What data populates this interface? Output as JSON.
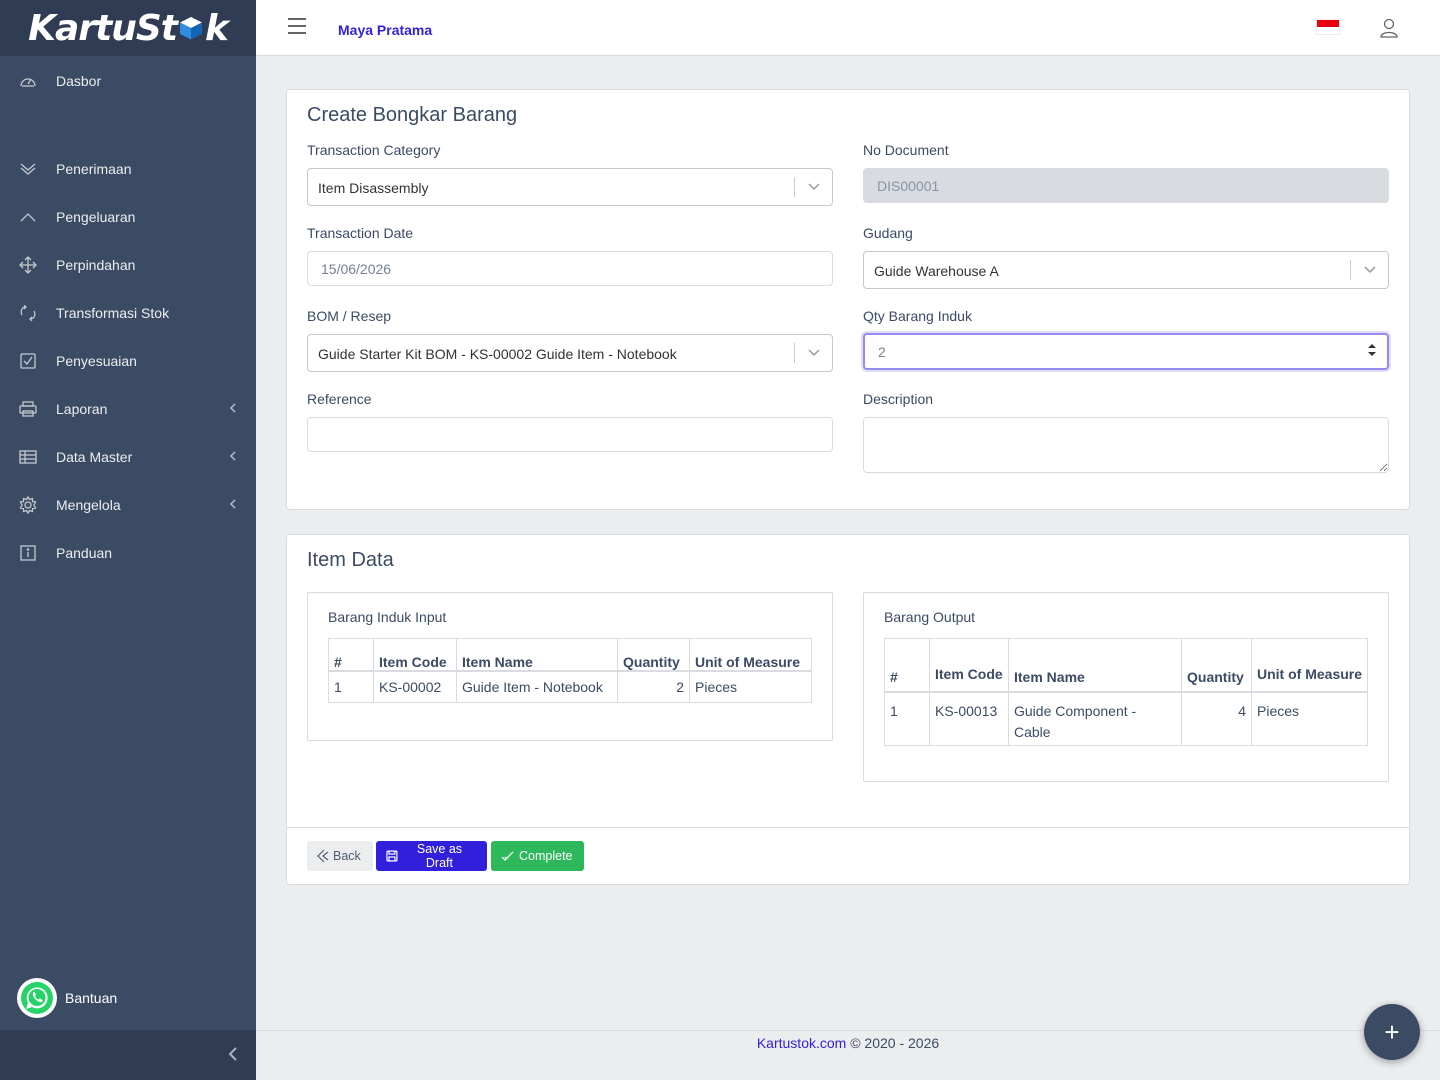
{
  "brand": {
    "name_part1": "KartuSt",
    "name_part2": "k"
  },
  "sidebar": {
    "items": [
      {
        "label": "Dasbor",
        "icon": "speedometer-icon"
      },
      {
        "label": "Penerimaan",
        "icon": "chevron-double-down-icon"
      },
      {
        "label": "Pengeluaran",
        "icon": "chevron-up-icon"
      },
      {
        "label": "Perpindahan",
        "icon": "move-icon"
      },
      {
        "label": "Transformasi Stok",
        "icon": "transform-icon"
      },
      {
        "label": "Penyesuaian",
        "icon": "checkbox-icon"
      },
      {
        "label": "Laporan",
        "icon": "printer-icon"
      },
      {
        "label": "Data Master",
        "icon": "list-icon"
      },
      {
        "label": "Mengelola",
        "icon": "gear-icon"
      },
      {
        "label": "Panduan",
        "icon": "info-icon"
      }
    ],
    "help_label": "Bantuan"
  },
  "header": {
    "user_name": "Maya Pratama"
  },
  "form": {
    "title": "Create Bongkar Barang",
    "transaction_category": {
      "label": "Transaction Category",
      "value": "Item Disassembly"
    },
    "no_document": {
      "label": "No Document",
      "value": "DIS00001"
    },
    "transaction_date": {
      "label": "Transaction Date",
      "value": "15/06/2026"
    },
    "gudang": {
      "label": "Gudang",
      "value": "Guide Warehouse A"
    },
    "bom": {
      "label": "BOM / Resep",
      "value": "Guide Starter Kit BOM - KS-00002 Guide Item - Notebook"
    },
    "qty": {
      "label": "Qty Barang Induk",
      "value": "2"
    },
    "reference": {
      "label": "Reference",
      "value": ""
    },
    "description": {
      "label": "Description",
      "value": ""
    }
  },
  "items": {
    "title": "Item Data",
    "input": {
      "title": "Barang Induk Input",
      "headers": [
        "#",
        "Item Code",
        "Item Name",
        "Quantity",
        "Unit of Measure"
      ],
      "rows": [
        [
          "1",
          "KS-00002",
          "Guide Item - Notebook",
          "2",
          "Pieces"
        ]
      ]
    },
    "output": {
      "title": "Barang Output",
      "headers": [
        "#",
        "Item Code",
        "Item Name",
        "Quantity",
        "Unit of Measure"
      ],
      "rows": [
        [
          "1",
          "KS-00013",
          "Guide Component - Cable",
          "4",
          "Pieces"
        ]
      ]
    }
  },
  "buttons": {
    "back": "Back",
    "save_draft": "Save as Draft",
    "complete": "Complete"
  },
  "footer": {
    "link": "Kartustok.com",
    "text": " © 2020 - 2026"
  },
  "fab": "+",
  "colors": {
    "primary": "#321fdb",
    "success": "#2eb85c",
    "sidebar": "#3c4b64"
  }
}
